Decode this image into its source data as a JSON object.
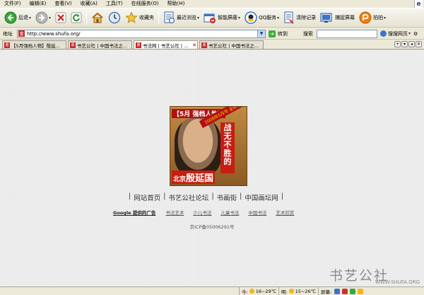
{
  "menubar": {
    "items": [
      "文件(F)",
      "编辑(E)",
      "查看(V)",
      "收藏(A)",
      "工具(T)",
      "在线服务(O)",
      "帮助(H)"
    ]
  },
  "toolbar": {
    "back_label": "后退",
    "favorites_label": "收藏夹",
    "recent_label": "最近浏览",
    "smart_block_label": "智能屏蔽",
    "qq_label": "QQ服务",
    "clear_label": "清除记录",
    "capture_label": "捕捉屏幕",
    "photo_label": "拍拍"
  },
  "addressbar": {
    "label": "地址",
    "url": "http://www.shufa.org/",
    "go_label": "转到",
    "search_label": "搜索",
    "search_placeholder": "",
    "search_btn_label": "搜搜网页"
  },
  "tabs": [
    {
      "title": "【5月强档人物】殷延...",
      "active": false
    },
    {
      "title": "书艺公社 | 中国书法之...",
      "active": false
    },
    {
      "title": "书法网 | 书艺公社 | ...",
      "active": true
    },
    {
      "title": "书艺公社 | 中国书法之...",
      "active": false
    }
  ],
  "banner": {
    "top_left": "【5月 强档人物】",
    "top_right": "2008年5月号 全新出版",
    "slogan": "战无不胜的",
    "city": "北京",
    "name": "殷延国"
  },
  "nav": {
    "links": [
      "网站首页",
      "书艺公社论坛",
      "书画街",
      "中国画坛网"
    ]
  },
  "ads": {
    "label": "Google 提供的广告",
    "links": [
      "书法艺术",
      "少儿书法",
      "儿童书法",
      "中国书法",
      "艺术欣赏"
    ]
  },
  "footer": {
    "icp": "京ICP备05006291号"
  },
  "watermark": {
    "title": "书艺公社",
    "url": "WWW.SHUFA.ORG"
  },
  "statusbar": {
    "today_label": "今:",
    "today_temp": "16~29℃",
    "tomorrow_label": "明:",
    "tomorrow_temp": "15~26℃",
    "screen_label": "屏幕:"
  }
}
